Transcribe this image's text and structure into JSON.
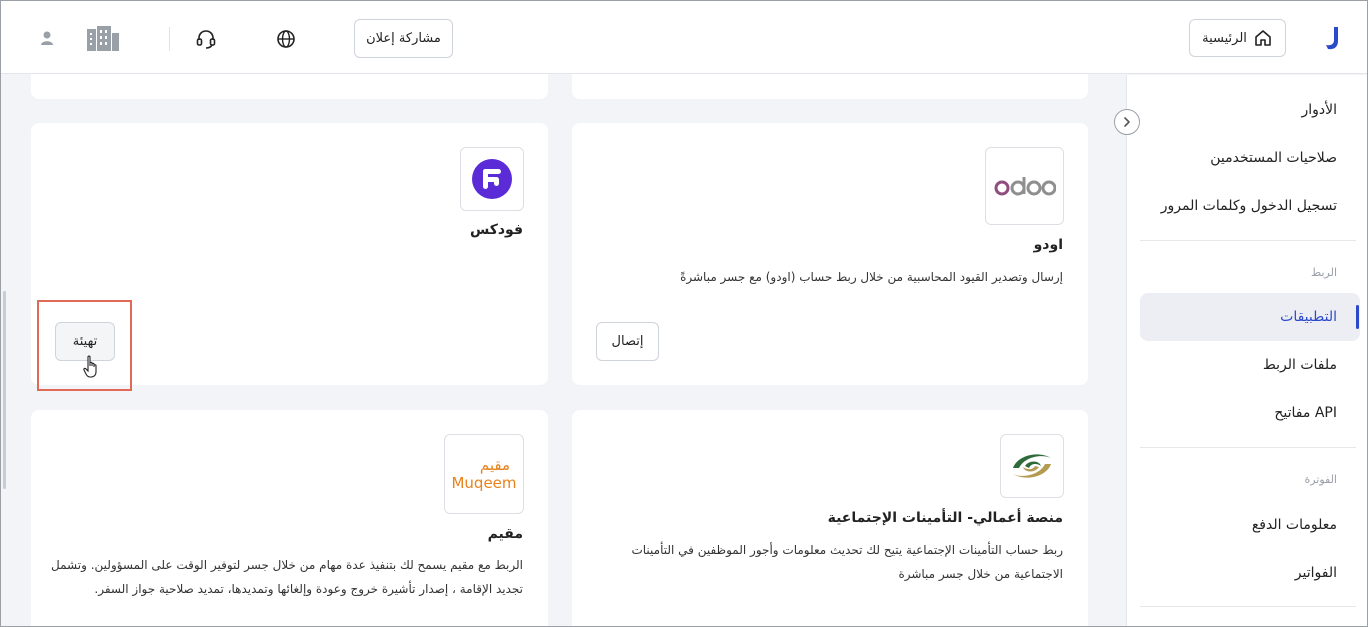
{
  "header": {
    "home_label": "الرئيسية",
    "share_ad_label": "مشاركة إعلان",
    "icons": [
      "logo-icon",
      "home-icon",
      "globe-icon",
      "headset-icon",
      "building-icon",
      "user-icon"
    ]
  },
  "sidebar": {
    "items_top": [
      "الأدوار",
      "صلاحيات المستخدمين",
      "تسجيل الدخول وكلمات المرور"
    ],
    "section_link": "الربط",
    "link_items": [
      "التطبيقات",
      "ملفات الربط",
      "مفاتيح API"
    ],
    "section_billing": "الفوترة",
    "billing_items": [
      "معلومات الدفع",
      "الفواتير"
    ],
    "active_item": "التطبيقات"
  },
  "cards": {
    "odoo": {
      "logo_text": "odoo",
      "title": "اودو",
      "description": "إرسال وتصدير القيود المحاسبية من خلال ربط حساب (اودو) مع جسر مباشرةً",
      "button": "إتصال"
    },
    "foodics": {
      "title": "فودكس",
      "button": "تهيئة"
    },
    "gosi": {
      "title": "منصة أعمالي- التأمينات الإجتماعية",
      "description": "ربط حساب التأمينات الإجتماعية يتيح لك تحديث معلومات وأجور الموظفين في التأمينات الاجتماعية من خلال جسر مباشرة"
    },
    "muqeem": {
      "logo_ar": "مقيم",
      "logo_en": "Muqeem",
      "title": "مقيم",
      "description": "الربط مع مقيم يسمح لك بتنفيذ عدة مهام من خلال جسر لتوفير الوقت على المسؤولين. وتشمل تجديد الإقامة ، إصدار تأشيرة خروج وعودة وإلغائها وتمديدها، تمديد صلاحية جواز السفر."
    }
  },
  "colors": {
    "accent": "#2b4acb",
    "foodics": "#5a2bd6",
    "odoo_purple": "#8f4f7e",
    "odoo_gray": "#8f8f8f",
    "muqeem_orange": "#e8821a",
    "highlight": "#e06a55"
  }
}
